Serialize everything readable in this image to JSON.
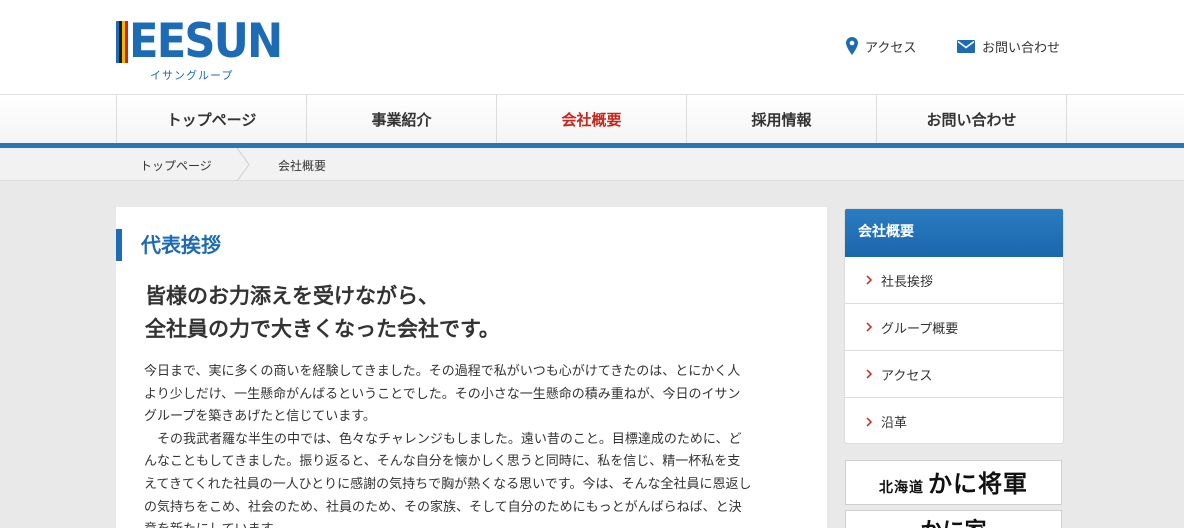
{
  "header": {
    "logo_text": "EESUN",
    "logo_sub": "イサングループ",
    "access_label": "アクセス",
    "contact_label": "お問い合わせ",
    "colors": {
      "brand_blue": "#1d6bb5",
      "accent_red": "#c8261b",
      "stripe_yellow": "#f2b700",
      "stripe_black": "#1a1a1a"
    }
  },
  "nav": {
    "items": [
      {
        "label": "トップページ"
      },
      {
        "label": "事業紹介"
      },
      {
        "label": "会社概要",
        "active": true
      },
      {
        "label": "採用情報"
      },
      {
        "label": "お問い合わせ"
      }
    ]
  },
  "breadcrumb": {
    "home": "トップページ",
    "current": "会社概要"
  },
  "main": {
    "section_title": "代表挨拶",
    "lead_lines": [
      "皆様のお力添えを受けながら、",
      "全社員の力で大きくなった会社です。"
    ],
    "body_lines": [
      "今日まで、実に多くの商いを経験してきました。その過程で私がいつも心がけてきたのは、とにかく人",
      "より少しだけ、一生懸命がんばるということでした。その小さな一生懸命の積み重ねが、今日のイサン",
      "グループを築きあげたと信じています。",
      "　その我武者羅な半生の中では、色々なチャレンジもしました。遠い昔のこと。目標達成のために、ど",
      "んなこともしてきました。振り返ると、そんな自分を懐かしく思うと同時に、私を信じ、精一杯私を支",
      "えてきてくれた社員の一人ひとりに感謝の気持ちで胸が熱くなる思いです。今は、そんな全社員に恩返し",
      "の気持ちをこめ、社会のため、社員のため、その家族、そして自分のためにもっとがんばらねば、と決",
      "意を新たにしています。"
    ]
  },
  "sidebar": {
    "title": "会社概要",
    "items": [
      {
        "label": "社長挨拶"
      },
      {
        "label": "グループ概要"
      },
      {
        "label": "アクセス"
      },
      {
        "label": "沿革"
      }
    ]
  },
  "banners": {
    "banner1_small": "北海道",
    "banner1_main": "かに将軍",
    "banner2_main": "かに家"
  }
}
